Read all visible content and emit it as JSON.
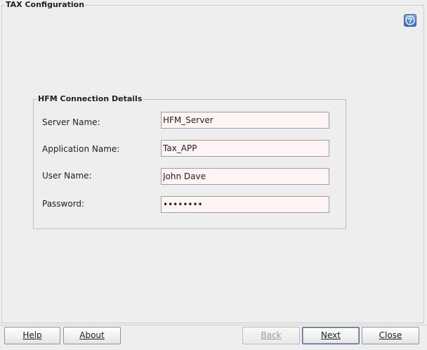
{
  "window": {
    "title": "TAX Configuration"
  },
  "help_icon": "question-mark-help-icon",
  "connection": {
    "group_title": "HFM Connection Details",
    "fields": [
      {
        "label": "Server Name:",
        "value": "HFM_Server"
      },
      {
        "label": "Application Name:",
        "value": "Tax_APP"
      },
      {
        "label": "User Name:",
        "value": "John Dave"
      },
      {
        "label": "Password:",
        "value": "••••••••"
      }
    ]
  },
  "buttons": {
    "help": "Help",
    "about": "About",
    "back": "Back",
    "next": "Next",
    "close": "Close"
  },
  "colors": {
    "input_background": "#fff4f4",
    "window_background": "#eeeeee",
    "help_icon_blue": "#2f6ec0"
  }
}
